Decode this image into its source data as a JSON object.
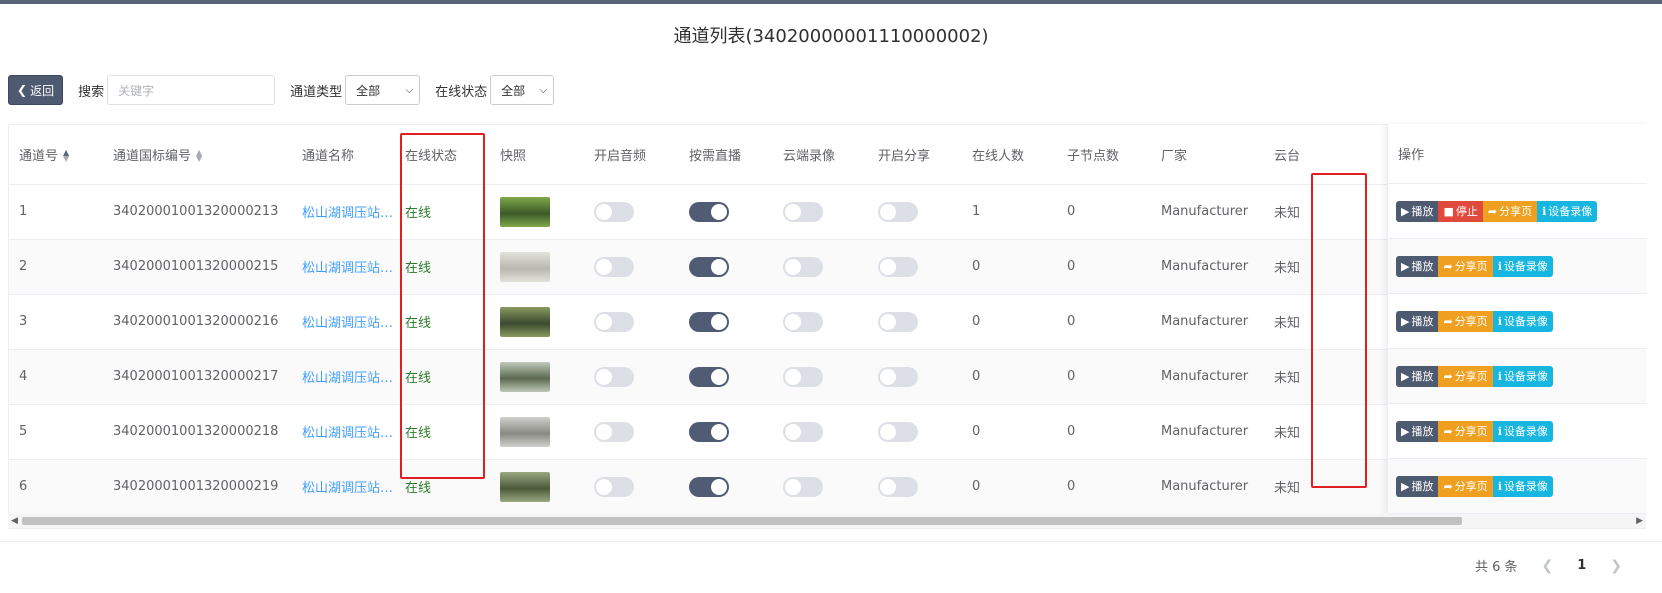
{
  "title": "通道列表(34020000001110000002)",
  "toolbar": {
    "back_label": "返回",
    "search_label": "搜索",
    "search_placeholder": "关键字",
    "type_label": "通道类型",
    "type_value": "全部",
    "status_label": "在线状态",
    "status_value": "全部"
  },
  "table": {
    "columns": [
      "通道号",
      "通道国标编号",
      "通道名称",
      "在线状态",
      "快照",
      "开启音频",
      "按需直播",
      "云端录像",
      "开启分享",
      "在线人数",
      "子节点数",
      "厂家",
      "云台",
      "操作"
    ],
    "rows": [
      {
        "no": "1",
        "gb": "34020001001320000213",
        "name": "松山湖调压站…",
        "status": "在线",
        "audio": false,
        "ondemand": true,
        "cloud": false,
        "share": false,
        "viewers": "1",
        "children": "0",
        "maker": "Manufacturer",
        "ptz": "未知",
        "playing": true
      },
      {
        "no": "2",
        "gb": "34020001001320000215",
        "name": "松山湖调压站…",
        "status": "在线",
        "audio": false,
        "ondemand": true,
        "cloud": false,
        "share": false,
        "viewers": "0",
        "children": "0",
        "maker": "Manufacturer",
        "ptz": "未知",
        "playing": false
      },
      {
        "no": "3",
        "gb": "34020001001320000216",
        "name": "松山湖调压站…",
        "status": "在线",
        "audio": false,
        "ondemand": true,
        "cloud": false,
        "share": false,
        "viewers": "0",
        "children": "0",
        "maker": "Manufacturer",
        "ptz": "未知",
        "playing": false
      },
      {
        "no": "4",
        "gb": "34020001001320000217",
        "name": "松山湖调压站…",
        "status": "在线",
        "audio": false,
        "ondemand": true,
        "cloud": false,
        "share": false,
        "viewers": "0",
        "children": "0",
        "maker": "Manufacturer",
        "ptz": "未知",
        "playing": false
      },
      {
        "no": "5",
        "gb": "34020001001320000218",
        "name": "松山湖调压站…",
        "status": "在线",
        "audio": false,
        "ondemand": true,
        "cloud": false,
        "share": false,
        "viewers": "0",
        "children": "0",
        "maker": "Manufacturer",
        "ptz": "未知",
        "playing": false
      },
      {
        "no": "6",
        "gb": "34020001001320000219",
        "name": "松山湖调压站…",
        "status": "在线",
        "audio": false,
        "ondemand": true,
        "cloud": false,
        "share": false,
        "viewers": "0",
        "children": "0",
        "maker": "Manufacturer",
        "ptz": "未知",
        "playing": false
      }
    ]
  },
  "actions": {
    "play": "播放",
    "stop": "停止",
    "share": "分享页",
    "record": "设备录像"
  },
  "pagination": {
    "total": "共 6 条",
    "current": "1"
  },
  "colors": {
    "primary": "#4e5a70",
    "danger": "#e04a3c",
    "warning": "#f0a020",
    "info": "#16b6e0",
    "online": "#2c7a2c",
    "highlight": "#e02020"
  }
}
